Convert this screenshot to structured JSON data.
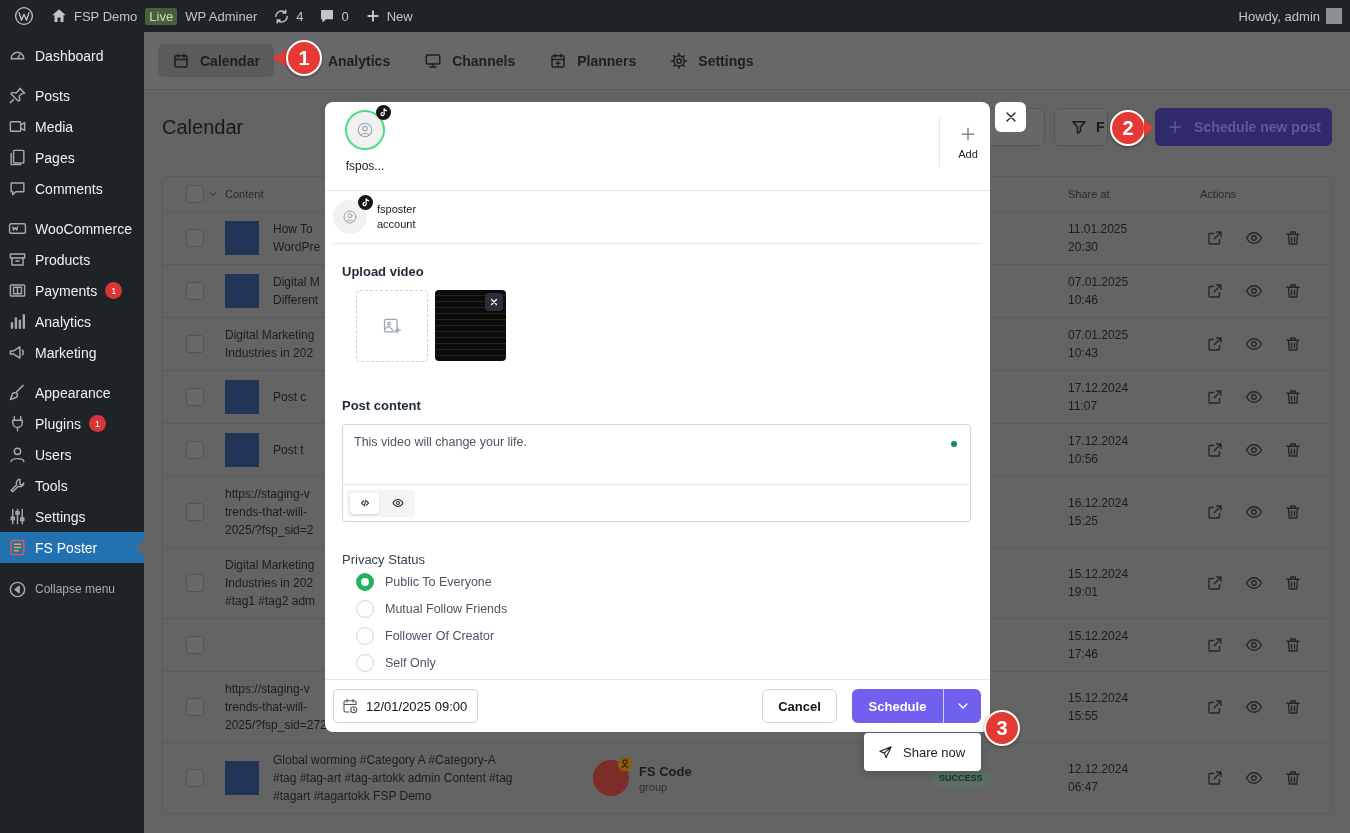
{
  "admin_bar": {
    "site_name": "FSP Demo",
    "environment_badge": "Live",
    "adminer_link": "WP Adminer",
    "updates_count": "4",
    "comments_count": "0",
    "new_label": "New",
    "greeting": "Howdy, admin"
  },
  "sidebar": {
    "groups": [
      {
        "items": [
          {
            "label": "Dashboard",
            "selected": false
          }
        ]
      },
      {
        "items": [
          {
            "label": "Posts",
            "selected": false
          },
          {
            "label": "Media",
            "selected": false
          },
          {
            "label": "Pages",
            "selected": false
          },
          {
            "label": "Comments",
            "selected": false
          }
        ]
      },
      {
        "items": [
          {
            "label": "WooCommerce",
            "selected": false
          },
          {
            "label": "Products",
            "selected": false
          },
          {
            "label": "Payments",
            "badge": "1",
            "selected": false
          },
          {
            "label": "Analytics",
            "selected": false
          },
          {
            "label": "Marketing",
            "selected": false
          }
        ]
      },
      {
        "items": [
          {
            "label": "Appearance",
            "selected": false
          },
          {
            "label": "Plugins",
            "badge": "1",
            "selected": false
          },
          {
            "label": "Users",
            "selected": false
          },
          {
            "label": "Tools",
            "selected": false
          },
          {
            "label": "Settings",
            "selected": false
          },
          {
            "label": "FS Poster",
            "selected": true
          }
        ]
      }
    ],
    "collapse_label": "Collapse menu"
  },
  "tabs": [
    {
      "label": "Calendar",
      "selected": true
    },
    {
      "label": "Analytics",
      "selected": false
    },
    {
      "label": "Channels",
      "selected": false
    },
    {
      "label": "Planners",
      "selected": false
    },
    {
      "label": "Settings",
      "selected": false
    }
  ],
  "page_title": "Calendar",
  "toolbar": {
    "filter_label": "F",
    "primary_button": "Schedule new post"
  },
  "table": {
    "select_all_checked": false,
    "columns": {
      "content": "Content",
      "share_at": "Share at",
      "actions": "Actions"
    },
    "rows": [
      {
        "checked": false,
        "thumbnail": true,
        "content": "How To\nWordPre",
        "share_at": "11.01.2025\n20:30"
      },
      {
        "checked": false,
        "thumbnail": true,
        "content": "Digital M\nDifferent",
        "share_at": "07.01.2025\n10:46"
      },
      {
        "checked": false,
        "thumbnail": false,
        "content": "Digital Marketing\nIndustries in 202",
        "share_at": "07.01.2025\n10:43"
      },
      {
        "checked": false,
        "thumbnail": true,
        "content": "Post c",
        "share_at": "17.12.2024\n11:07"
      },
      {
        "checked": false,
        "thumbnail": true,
        "content": "Post t",
        "share_at": "17.12.2024\n10:56"
      },
      {
        "checked": false,
        "thumbnail": false,
        "content": "https://staging-v\ntrends-that-will-\n2025/?fsp_sid=2",
        "share_at": "16.12.2024\n15:25"
      },
      {
        "checked": false,
        "thumbnail": false,
        "content": "Digital Marketing\nIndustries in 202\n#tag1 #tag2 adm",
        "share_at": "15.12.2024\n19:01"
      },
      {
        "checked": false,
        "thumbnail": false,
        "share_at": "15.12.2024\n17:46"
      },
      {
        "checked": false,
        "thumbnail": false,
        "content": "https://staging-v\ntrends-that-will-\n2025/?fsp_sid=272",
        "share_at": "15.12.2024\n15:55"
      },
      {
        "checked": false,
        "thumbnail": true,
        "content": "Global worming #Category A #Category-A\n#tag #tag-art #tag-artokk admin Content #tag\n#tagart #tagartokk FSP Demo",
        "account": {
          "name": "FS Code",
          "type": "group"
        },
        "status": "SUCCESS",
        "share_at": "12.12.2024\n06:47"
      }
    ]
  },
  "modal": {
    "selected_accounts": [
      {
        "label": "fspos...",
        "selected": true
      }
    ],
    "add_label": "Add",
    "account": {
      "name": "fsposter",
      "type": "account"
    },
    "upload_label": "Upload video",
    "content_label": "Post content",
    "content_value": "This video will change your life.",
    "editor_modes": [
      {
        "selected": true
      },
      {
        "selected": false
      }
    ],
    "privacy_label": "Privacy Status",
    "privacy_options": [
      {
        "label": "Public To Everyone",
        "selected": true
      },
      {
        "label": "Mutual Follow Friends",
        "selected": false
      },
      {
        "label": "Follower Of Creator",
        "selected": false
      },
      {
        "label": "Self Only",
        "selected": false
      }
    ],
    "schedule_date": "12/01/2025 09:00",
    "cancel_label": "Cancel",
    "schedule_label": "Schedule",
    "menu": {
      "items": [
        {
          "label": "Share now"
        }
      ]
    }
  },
  "callouts": [
    {
      "number": "1",
      "kind": "left"
    },
    {
      "number": "2",
      "kind": "right"
    },
    {
      "number": "3",
      "kind": "plain"
    }
  ]
}
